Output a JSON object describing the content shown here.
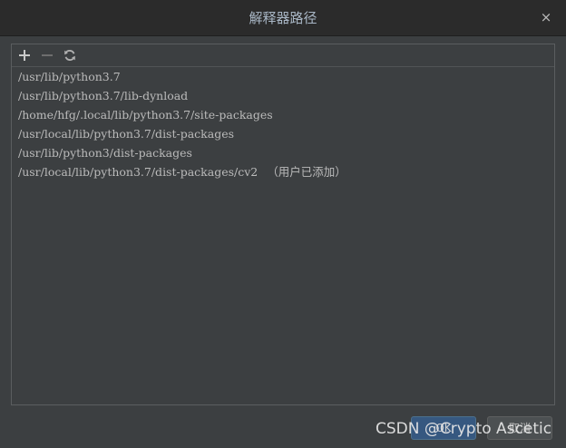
{
  "dialog": {
    "title": "解释器路径",
    "close_glyph": "×"
  },
  "toolbar": {
    "add_icon": "plus-icon",
    "remove_icon": "minus-icon",
    "refresh_icon": "refresh-icon"
  },
  "paths": [
    {
      "path": "/usr/lib/python3.7",
      "note": ""
    },
    {
      "path": "/usr/lib/python3.7/lib-dynload",
      "note": ""
    },
    {
      "path": "/home/hfg/.local/lib/python3.7/site-packages",
      "note": ""
    },
    {
      "path": "/usr/local/lib/python3.7/dist-packages",
      "note": ""
    },
    {
      "path": "/usr/lib/python3/dist-packages",
      "note": ""
    },
    {
      "path": "/usr/local/lib/python3.7/dist-packages/cv2",
      "note": "（用户已添加）"
    }
  ],
  "buttons": {
    "ok_label": "OK",
    "cancel_label": "取消"
  },
  "watermark": "CSDN @Crypto Ascetic",
  "colors": {
    "accent": "#365880",
    "background": "#3c3f41",
    "titlebar": "#2b2b2b",
    "add_icon": "#c9c9c9",
    "remove_icon_disabled": "#6e6e6e",
    "refresh_icon": "#b0b0b0"
  }
}
